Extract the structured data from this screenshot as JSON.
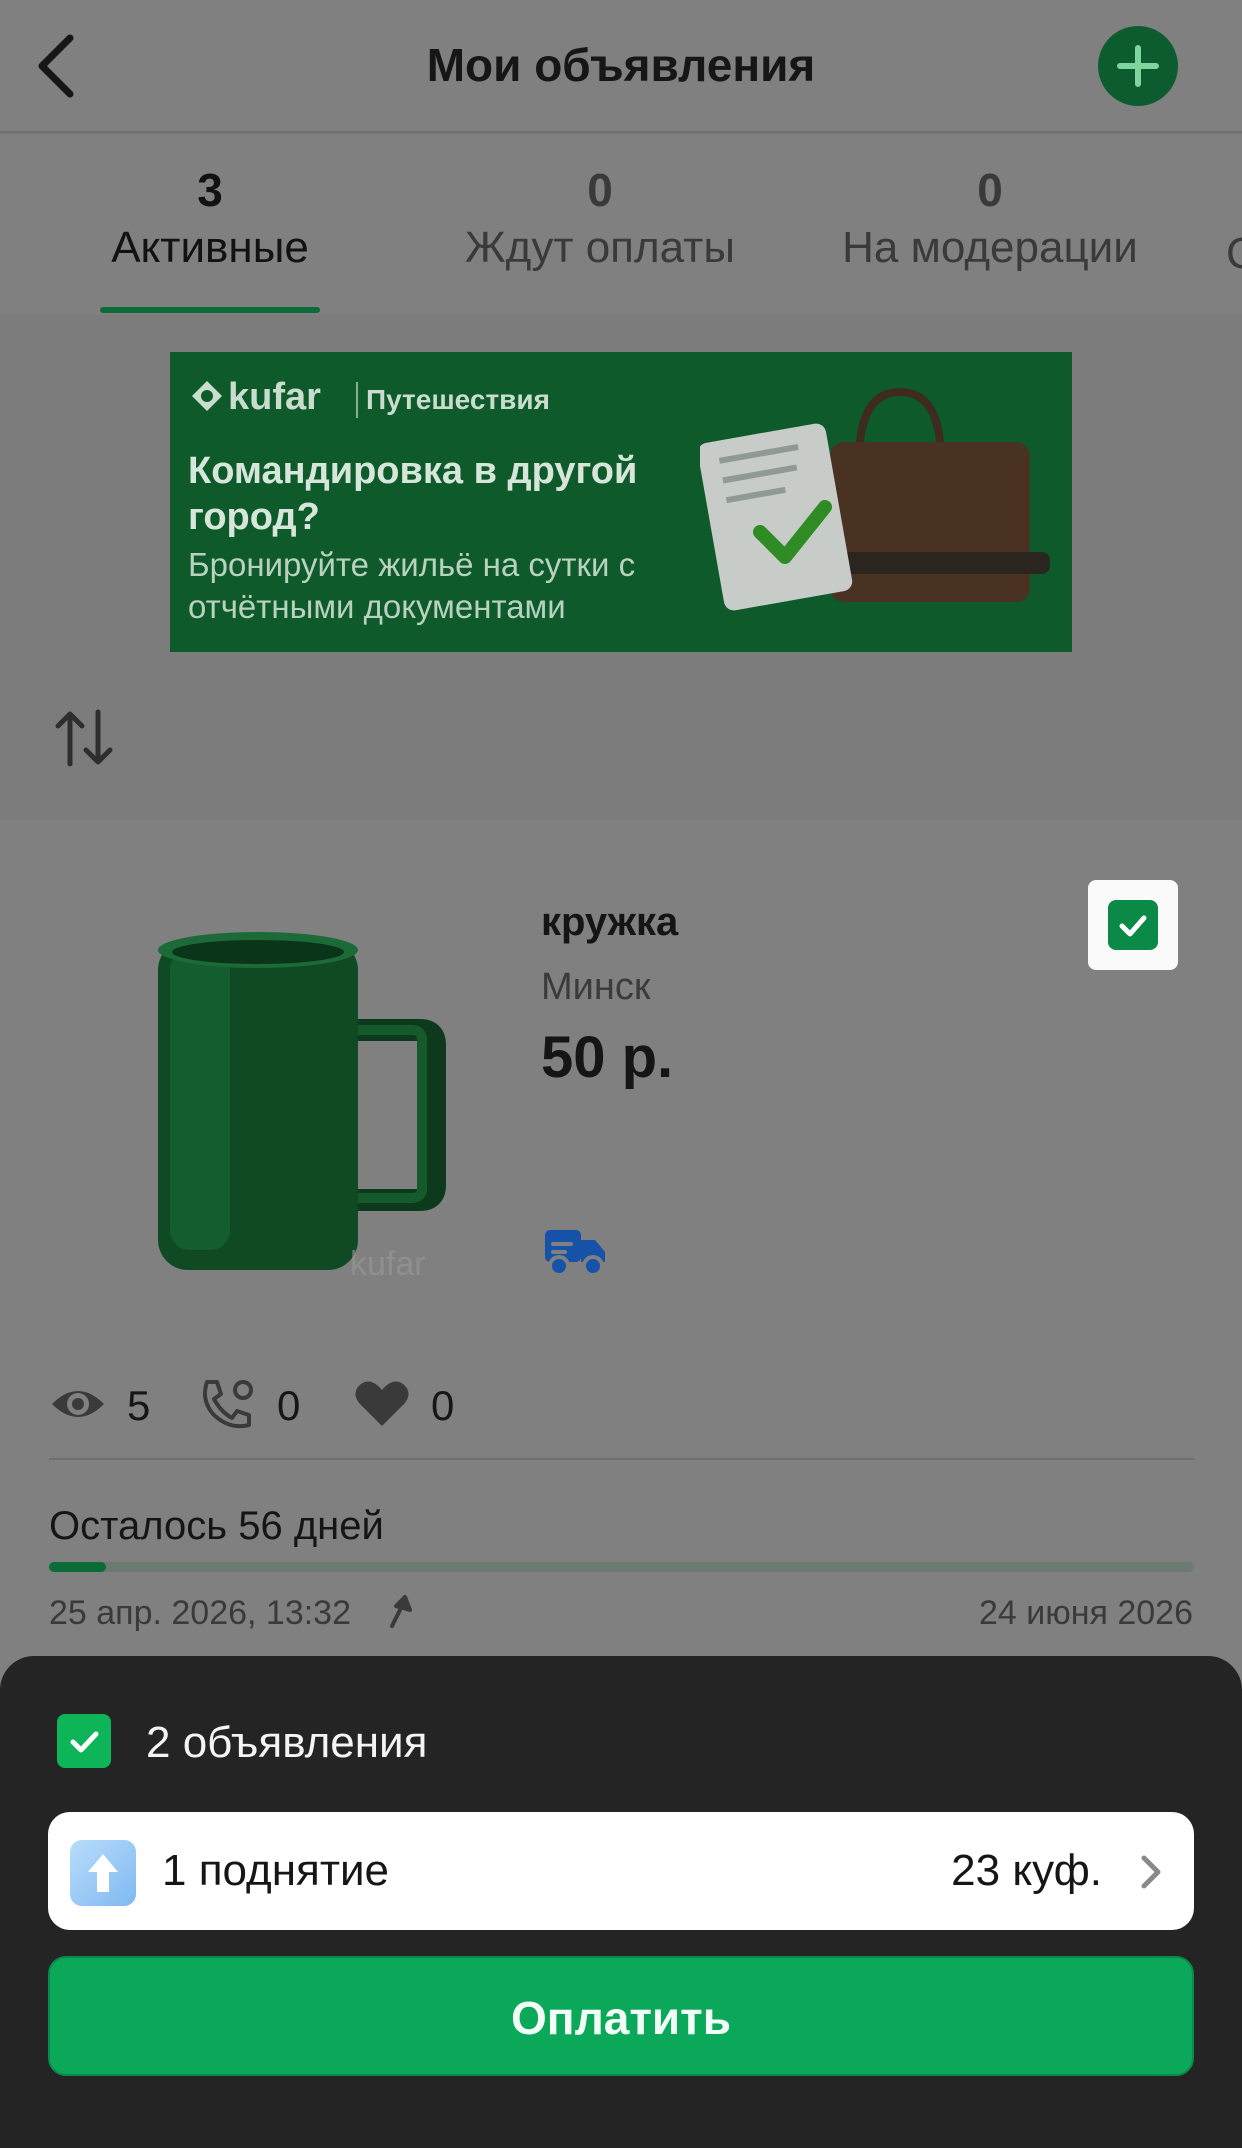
{
  "header": {
    "title": "Мои объявления",
    "back_icon": "chevron-left-icon",
    "add_icon": "plus-icon"
  },
  "tabs": [
    {
      "count": "3",
      "label": "Активные",
      "active": true
    },
    {
      "count": "0",
      "label": "Ждут оплаты",
      "active": false
    },
    {
      "count": "0",
      "label": "На модерации",
      "active": false
    },
    {
      "count": "",
      "label": "С",
      "active": false
    }
  ],
  "banner": {
    "brand": "kufar",
    "brand_sub": "Путешествия",
    "headline": "Командировка в другой город?",
    "text": "Бронируйте жильё на сутки с отчётными документами"
  },
  "listing": {
    "title": "кружка",
    "city": "Минск",
    "price": "50 р.",
    "watermark": "kufar",
    "stats": {
      "views": "5",
      "calls": "0",
      "favorites": "0"
    },
    "remaining": "Осталось 56 дней",
    "progress": 0.05,
    "date_start": "25 апр. 2026, 13:32",
    "date_end": "24 июня 2026",
    "selected": true
  },
  "sheet": {
    "selected_count": "2 объявления",
    "boost_label": "1 поднятие",
    "boost_price": "23 куф.",
    "pay_label": "Оплатить"
  },
  "colors": {
    "accent": "#0ba85a",
    "dark_green": "#0b6b39",
    "sheet_bg": "#242424"
  }
}
